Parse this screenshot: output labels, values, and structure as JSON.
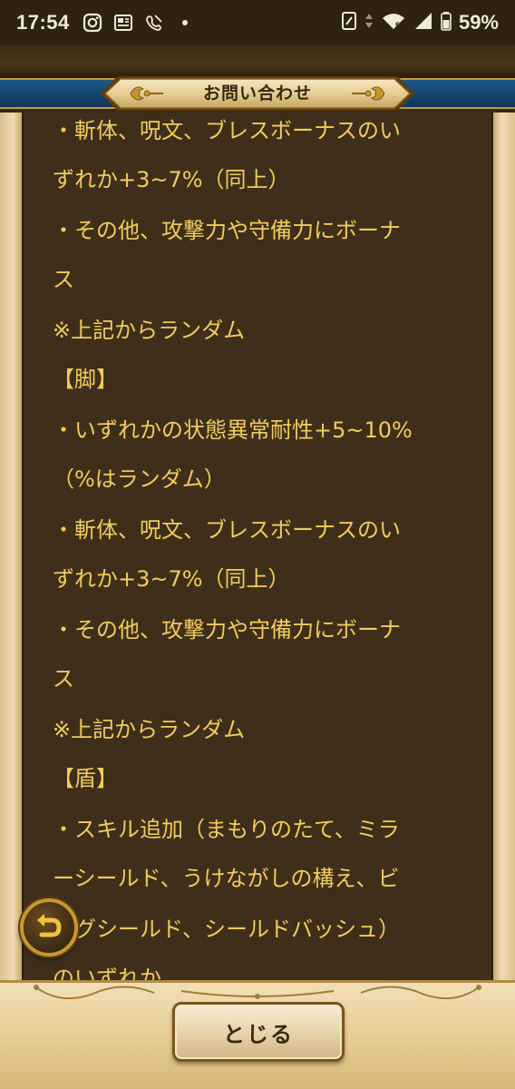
{
  "status_bar": {
    "time": "17:54",
    "battery": "59%",
    "icons": [
      "instagram-icon",
      "news-icon",
      "missed-call-icon",
      "dot-icon",
      "nfc-icon",
      "data-arrows-icon",
      "wifi-5-icon",
      "cell-signal-icon",
      "battery-icon"
    ]
  },
  "header": {
    "title": "お問い合わせ",
    "accent_color": "#1f5a8a"
  },
  "content": {
    "text_color": "#f3cb5a",
    "lines": [
      "・斬体、呪文、ブレスボーナスのい",
      "ずれか+3~7%（同上）",
      "・その他、攻撃力や守備力にボーナ",
      "ス",
      "※上記からランダム",
      "【脚】",
      "・いずれかの状態異常耐性+5~10%",
      "（%はランダム）",
      "・斬体、呪文、ブレスボーナスのい",
      "ずれか+3~7%（同上）",
      "・その他、攻撃力や守備力にボーナ",
      "ス",
      "※上記からランダム",
      "【盾】",
      "・スキル追加（まもりのたて、ミラ",
      "ーシールド、うけながしの構え、ビ",
      "ッグシールド、シールドバッシュ）",
      "のいずれか"
    ]
  },
  "back_button": {
    "icon": "return-arrow-icon"
  },
  "footer": {
    "close_label": "とじる"
  }
}
